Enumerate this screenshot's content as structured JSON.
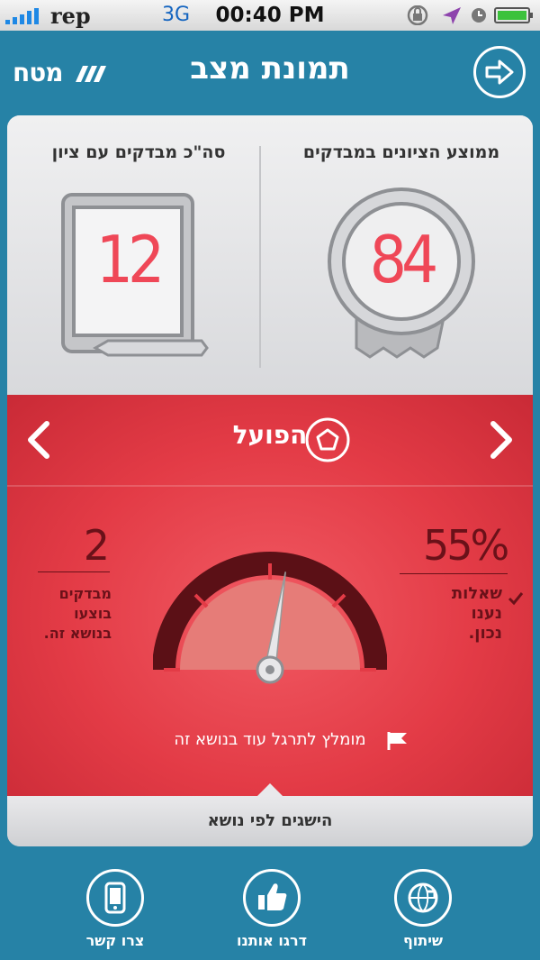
{
  "status_bar": {
    "carrier": "rep",
    "network": "3G",
    "time": "00:40 PM"
  },
  "header": {
    "logo": "מטח",
    "title": "תמונת מצב"
  },
  "stats": {
    "avg_label": "ממוצע הציונים במבדקים",
    "avg_value": "84",
    "count_label": "סה\"כ מבדקים עם ציון",
    "count_value": "12"
  },
  "topic": {
    "name": "הפועל",
    "correct_pct": "55%",
    "correct_label_lines": [
      "שאלות",
      "נענו",
      "נכון."
    ],
    "tests_done": "2",
    "tests_label_lines": [
      "מבדקים",
      "בוצעו",
      "בנושא זה."
    ],
    "gauge_value": 0.55,
    "recommendation": "מומלץ לתרגל עוד בנושא זה"
  },
  "achievements_bar": "הישגים לפי נושא",
  "bottom_nav": [
    {
      "label": "שיתוף",
      "icon": "share-globe-icon"
    },
    {
      "label": "דרגו אותנו",
      "icon": "thumbs-up-icon"
    },
    {
      "label": "צרו קשר",
      "icon": "phone-icon"
    }
  ],
  "colors": {
    "header_bg": "#2682a6",
    "accent_red": "#e33b46",
    "number_red": "#ef4757",
    "dark_red": "#6a1119"
  }
}
